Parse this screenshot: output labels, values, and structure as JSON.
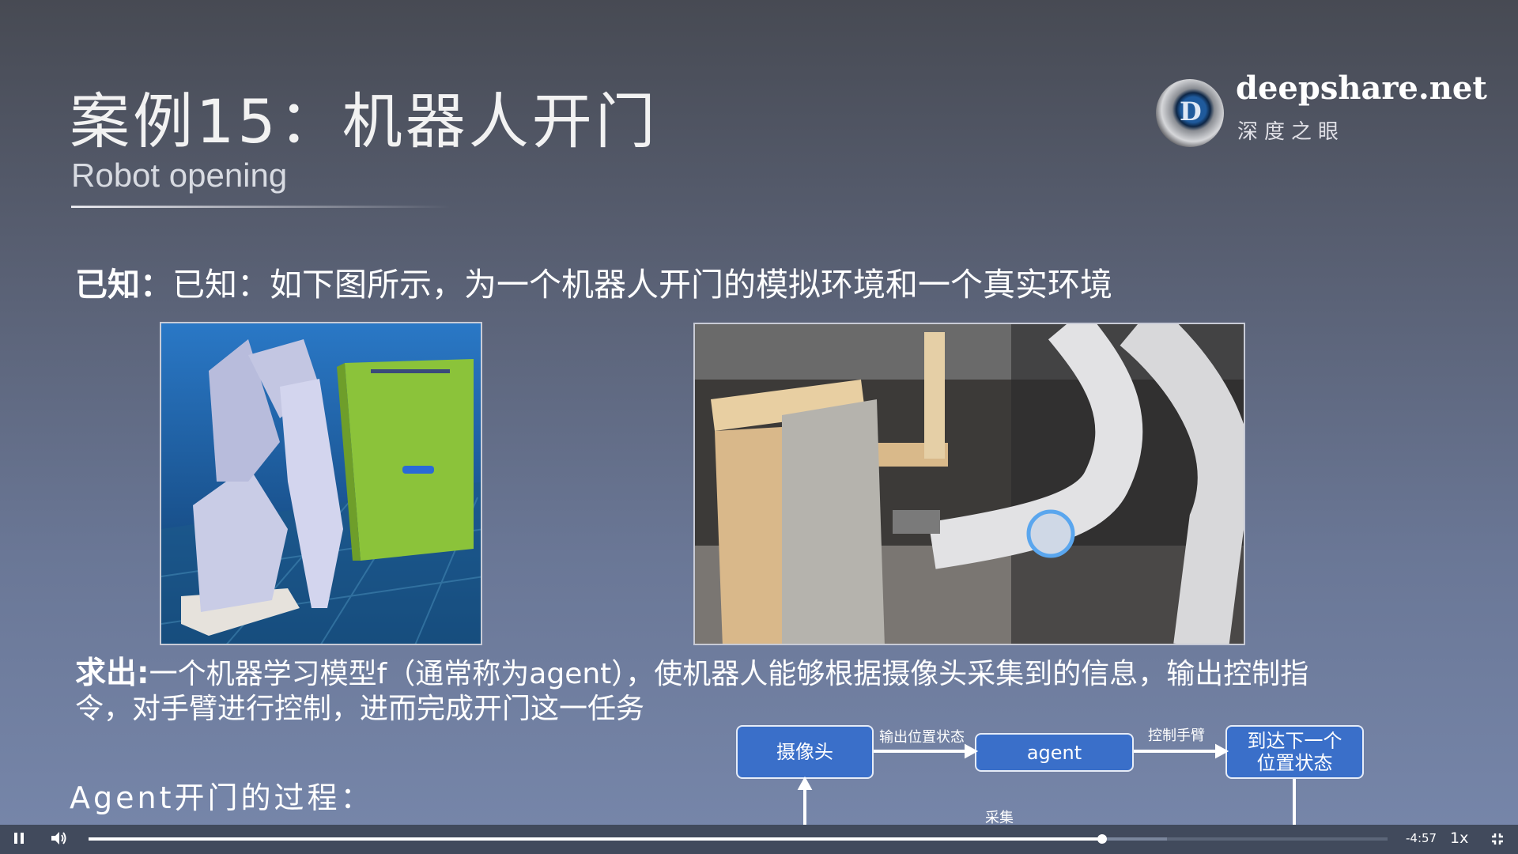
{
  "slide": {
    "title": "案例15：机器人开门",
    "subtitle": "Robot opening",
    "logo": {
      "name": "deepshare.net",
      "cn_name": "深度之眼",
      "letter": "D"
    },
    "known_label": "已知：",
    "known_text": "已知：如下图所示，为一个机器人开门的模拟环境和一个真实环境",
    "answer_label": "求出:",
    "answer_text": "一个机器学习模型f（通常称为agent），使机器人能够根据摄像头采集到的信息，输出控制指令，对手臂进行控制，进而完成开门这一任务",
    "process_label": "Agent开门的过程：",
    "diagram": {
      "camera": "摄像头",
      "agent": "agent",
      "next_state": "到达下一个位置状态",
      "edge_output": "输出位置状态",
      "edge_control": "控制手臂",
      "edge_collect": "采集"
    }
  },
  "player": {
    "time_remaining": "-4:57",
    "speed": "1x",
    "progress_percent": 78,
    "buffered_percent": 83,
    "icons": [
      "pause-icon",
      "volume-icon",
      "exit-fullscreen-icon"
    ]
  }
}
